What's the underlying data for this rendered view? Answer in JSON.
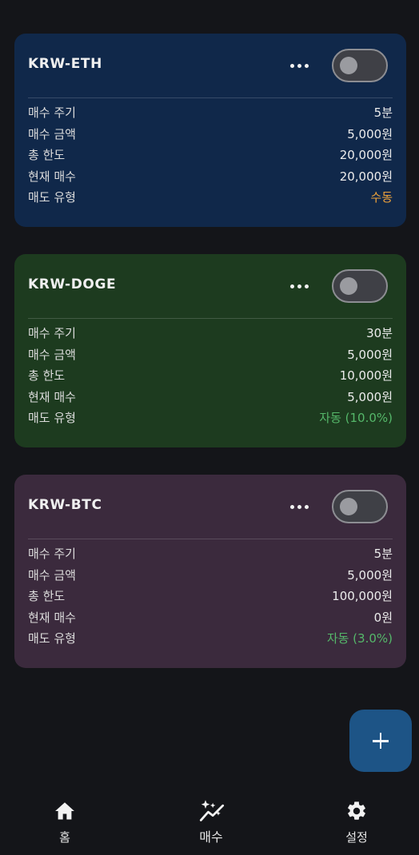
{
  "cards": [
    {
      "ticker": "KRW-ETH",
      "bg": "#10284a",
      "rows": [
        {
          "label": "매수 주기",
          "value": "5분"
        },
        {
          "label": "매수 금액",
          "value": "5,000원"
        },
        {
          "label": "총 한도",
          "value": "20,000원"
        },
        {
          "label": "현재 매수",
          "value": "20,000원"
        },
        {
          "label": "매도 유형",
          "value": "수동"
        }
      ]
    },
    {
      "ticker": "KRW-DOGE",
      "bg": "#1d3b1f",
      "rows": [
        {
          "label": "매수 주기",
          "value": "30분"
        },
        {
          "label": "매수 금액",
          "value": "5,000원"
        },
        {
          "label": "총 한도",
          "value": "10,000원"
        },
        {
          "label": "현재 매수",
          "value": "5,000원"
        },
        {
          "label": "매도 유형",
          "value": "자동 (10.0%)"
        }
      ]
    },
    {
      "ticker": "KRW-BTC",
      "bg": "#3b2a3d",
      "rows": [
        {
          "label": "매수 주기",
          "value": "5분"
        },
        {
          "label": "매수 금액",
          "value": "5,000원"
        },
        {
          "label": "총 한도",
          "value": "100,000원"
        },
        {
          "label": "현재 매수",
          "value": "0원"
        },
        {
          "label": "매도 유형",
          "value": "자동 (3.0%)"
        }
      ]
    }
  ],
  "colors": {
    "background": "#141519",
    "manual": "#f0a43a",
    "auto": "#55b86a",
    "fab": "#1d5486"
  },
  "icons": {
    "more": "more-horizontal-icon",
    "add": "plus-icon",
    "home": "home-icon",
    "buy": "sparkle-chart-icon",
    "settings": "gear-icon"
  },
  "nav": {
    "home": "홈",
    "buy": "매수",
    "settings": "설정"
  }
}
